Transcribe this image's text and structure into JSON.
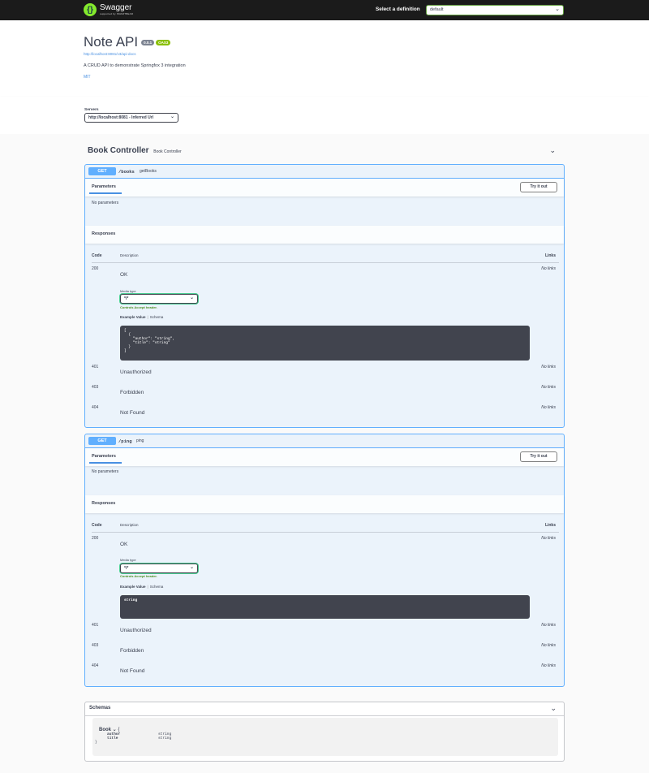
{
  "topbar": {
    "logo_name": "Swagger",
    "logo_sub": "supported by SMARTBEAR",
    "definition_label": "Select a definition",
    "definition_value": "default"
  },
  "info": {
    "title": "Note API",
    "version": "0.0.1",
    "oas": "OAS3",
    "docs_url": "http://localhost:8081/v3/api-docs",
    "description": "A CRUD API to demonstrate Springfox 3 integration",
    "license": "MIT"
  },
  "servers": {
    "label": "Servers",
    "selected": "http://localhost:8081 - Inferred Url"
  },
  "tag": {
    "name": "Book Controller",
    "description": "Book Controller"
  },
  "operations": [
    {
      "method": "GET",
      "path": "/books",
      "summary": "getBooks",
      "parameters_label": "Parameters",
      "try_label": "Try it out",
      "no_params": "No parameters",
      "responses_label": "Responses",
      "col_code": "Code",
      "col_description": "Description",
      "col_links": "Links",
      "responses": [
        {
          "code": "200",
          "description": "OK",
          "links": "No links"
        },
        {
          "code": "401",
          "description": "Unauthorized",
          "links": "No links"
        },
        {
          "code": "403",
          "description": "Forbidden",
          "links": "No links"
        },
        {
          "code": "404",
          "description": "Not Found",
          "links": "No links"
        }
      ],
      "media_label": "Media type",
      "media_value": "*/*",
      "media_note": "Controls Accept header.",
      "example_value_label": "Example Value",
      "schema_label": "Schema",
      "example": "[\n  {\n    \"author\": \"string\",\n    \"title\": \"string\"\n  }\n]"
    },
    {
      "method": "GET",
      "path": "/ping",
      "summary": "ping",
      "parameters_label": "Parameters",
      "try_label": "Try it out",
      "no_params": "No parameters",
      "responses_label": "Responses",
      "col_code": "Code",
      "col_description": "Description",
      "col_links": "Links",
      "responses": [
        {
          "code": "200",
          "description": "OK",
          "links": "No links"
        },
        {
          "code": "401",
          "description": "Unauthorized",
          "links": "No links"
        },
        {
          "code": "403",
          "description": "Forbidden",
          "links": "No links"
        },
        {
          "code": "404",
          "description": "Not Found",
          "links": "No links"
        }
      ],
      "media_label": "Media type",
      "media_value": "*/*",
      "media_note": "Controls Accept header.",
      "example_value_label": "Example Value",
      "schema_label": "Schema",
      "example": "string"
    }
  ],
  "schemas": {
    "title": "Schemas",
    "model_name": "Book",
    "model_open": "{",
    "model_close": "}",
    "properties": [
      {
        "name": "author",
        "type": "string"
      },
      {
        "name": "title",
        "type": "string"
      }
    ]
  },
  "colors": {
    "topbar": "#1b1b1b",
    "get": "#61affe",
    "accent_green": "#49cc90",
    "link": "#4990e2"
  },
  "icons": [
    "swagger-logo-icon",
    "chevron-down-icon"
  ]
}
